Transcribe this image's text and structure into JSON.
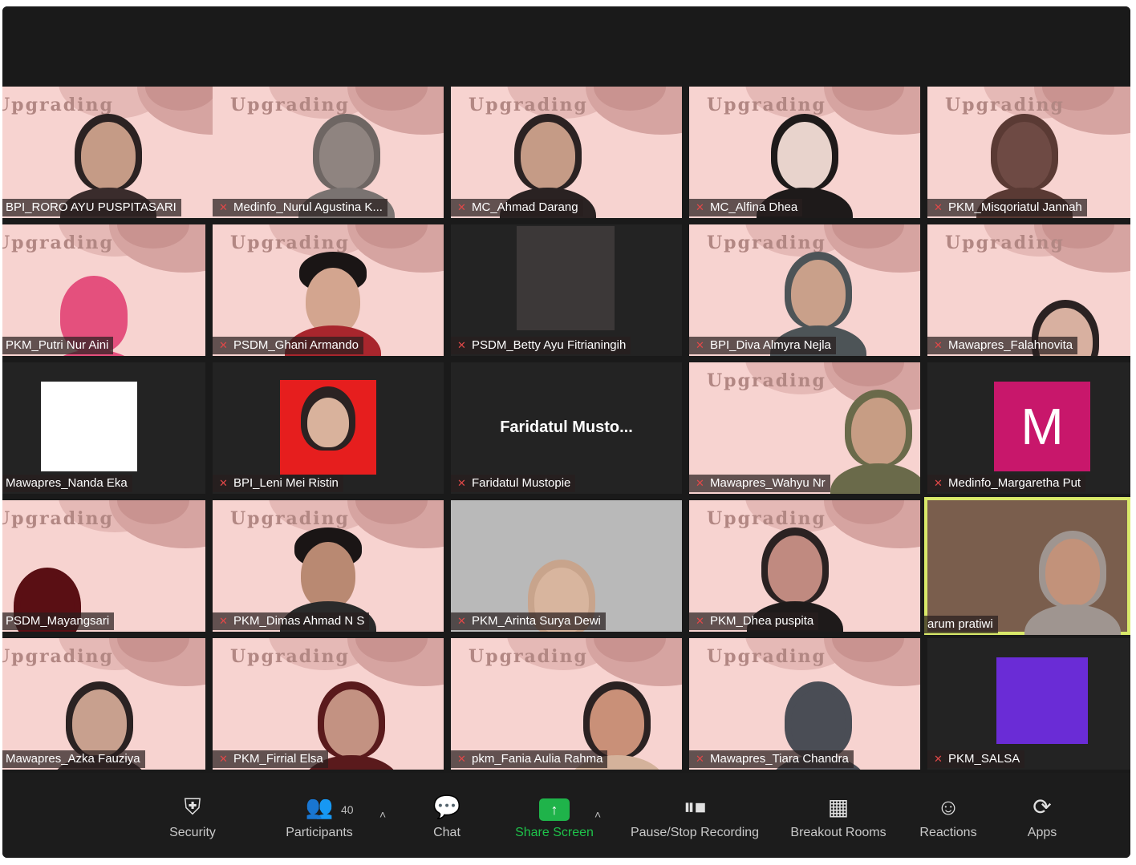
{
  "colors": {
    "tile_pink": "#f7d3d0",
    "active_border": "#d9e96a",
    "toolbar": "#1c1c1c",
    "share_green": "#1fb34a",
    "avatar_m": "#c8176b"
  },
  "tile_banner_text": "Upgrading",
  "participants": [
    {
      "name": "BPI_RORO AYU PUSPITASARI"
    },
    {
      "name": "Medinfo_Nurul Agustina K..."
    },
    {
      "name": "MC_Ahmad Darang"
    },
    {
      "name": "MC_Alfina Dhea"
    },
    {
      "name": "PKM_Misqoriatul Jannah"
    },
    {
      "name": "PKM_Putri Nur Aini"
    },
    {
      "name": "PSDM_Ghani Armando"
    },
    {
      "name": "PSDM_Betty Ayu Fitrianingih"
    },
    {
      "name": "BPI_Diva Almyra Nejla"
    },
    {
      "name": "Mawapres_Falahnovita"
    },
    {
      "name": "Mawapres_Nanda Eka"
    },
    {
      "name": "BPI_Leni Mei Ristin"
    },
    {
      "name": "Faridatul Mustopie",
      "center_label": "Faridatul  Musto..."
    },
    {
      "name": "Mawapres_Wahyu Nr"
    },
    {
      "name": "Medinfo_Margaretha Put",
      "avatar_letter": "M"
    },
    {
      "name": "PSDM_Mayangsari"
    },
    {
      "name": "PKM_Dimas Ahmad N S"
    },
    {
      "name": "PKM_Arinta Surya Dewi"
    },
    {
      "name": "PKM_Dhea puspita"
    },
    {
      "name": "arum pratiwi"
    },
    {
      "name": "Mawapres_Azka Fauziya"
    },
    {
      "name": "PKM_Firrial Elsa"
    },
    {
      "name": "pkm_Fania Aulia Rahma"
    },
    {
      "name": "Mawapres_Tiara Chandra"
    },
    {
      "name": "PKM_SALSA"
    }
  ],
  "toolbar": {
    "security": "Security",
    "participants": "Participants",
    "participants_count": "40",
    "chat": "Chat",
    "share_screen": "Share Screen",
    "recording": "Pause/Stop Recording",
    "breakout": "Breakout Rooms",
    "reactions": "Reactions",
    "apps": "Apps"
  }
}
